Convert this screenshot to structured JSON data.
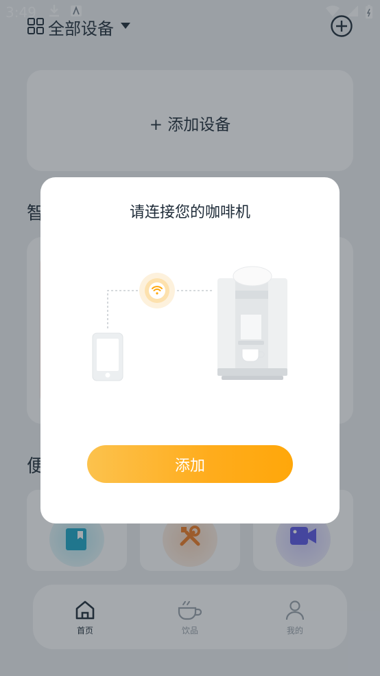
{
  "status_bar": {
    "time": "3:49"
  },
  "top_bar": {
    "title": "全部设备"
  },
  "add_device_card": {
    "label": "+ 添加设备"
  },
  "section1": {
    "title_visible": "智"
  },
  "section2": {
    "title_visible": "便"
  },
  "tiles": [
    {
      "icon": "bookmark-icon",
      "color": "#1aa7c9"
    },
    {
      "icon": "tools-icon",
      "color": "#f07a21"
    },
    {
      "icon": "video-icon",
      "color": "#5b55e6"
    }
  ],
  "bottom_nav": [
    {
      "label": "首页",
      "icon": "home-icon",
      "active": true
    },
    {
      "label": "饮品",
      "icon": "coffee-cup-icon",
      "active": false
    },
    {
      "label": "我的",
      "icon": "user-icon",
      "active": false
    }
  ],
  "dialog": {
    "title": "请连接您的咖啡机",
    "button_label": "添加",
    "illustration_icons": [
      "phone-icon",
      "wifi-icon",
      "coffee-machine-icon"
    ]
  },
  "colors": {
    "accent": "#ffac1c",
    "text_primary": "#1e2b38"
  }
}
